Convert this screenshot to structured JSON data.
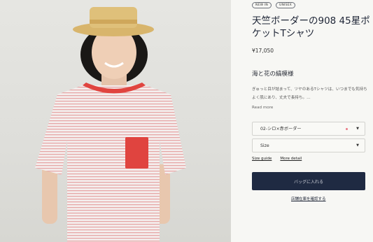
{
  "product": {
    "badges": [
      "NEW IN",
      "UNISEX"
    ],
    "title": "天竺ボーダーの908 45星ポケットTシャツ",
    "price": "¥17,050",
    "subhead": "海と花の縞模様",
    "description": "ぎゅっと目が詰まって、ツヤのあるTシャツは、いつまでも気持ちよく肌にあり、丈夫で長持ち。…",
    "read_more": "Read more"
  },
  "options": {
    "color_selected": "02-シロ×赤ボーダー",
    "size_placeholder": "Size",
    "chevron_icon": "chevron-down-icon",
    "swatch_color": "#e97a86"
  },
  "links": {
    "size_guide": "Size guide",
    "more_detail": "More detail"
  },
  "actions": {
    "add_to_bag": "バッグに入れる",
    "store_stock": "店舗在庫を確認する"
  },
  "colors": {
    "primary_button": "#1f2a42",
    "shirt_red": "#e0443f"
  }
}
